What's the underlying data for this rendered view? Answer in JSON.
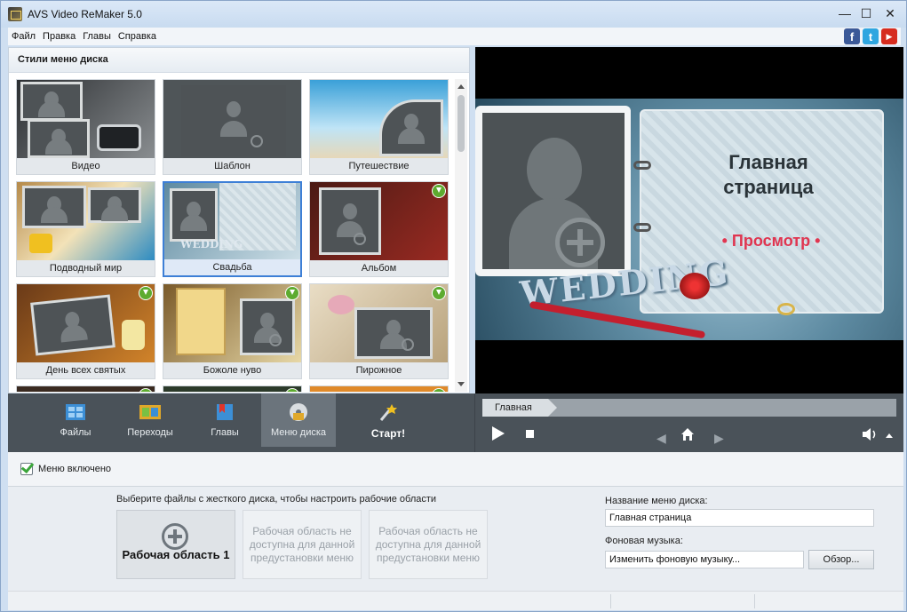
{
  "window": {
    "title": "AVS Video ReMaker 5.0",
    "minimize": "—",
    "maximize": "☐",
    "close": "✕"
  },
  "menu": [
    "Файл",
    "Правка",
    "Главы",
    "Справка"
  ],
  "social": {
    "facebook": "f",
    "twitter": "t",
    "youtube": "▶"
  },
  "styles_panel": {
    "title": "Стили меню диска",
    "tiles": [
      {
        "label": "Видео",
        "download": false
      },
      {
        "label": "Шаблон",
        "download": false
      },
      {
        "label": "Путешествие",
        "download": false
      },
      {
        "label": "Подводный мир",
        "download": false
      },
      {
        "label": "Свадьба",
        "download": false,
        "selected": true
      },
      {
        "label": "Альбом",
        "download": true
      },
      {
        "label": "День всех святых",
        "download": true
      },
      {
        "label": "Божоле нуво",
        "download": true
      },
      {
        "label": "Пирожное",
        "download": true
      }
    ]
  },
  "preview": {
    "title": "Главная страница",
    "link": "• Просмотр •",
    "decor_word": "WEDDING"
  },
  "toolbar": {
    "tools": [
      {
        "label": "Файлы",
        "icon": "film-icon"
      },
      {
        "label": "Переходы",
        "icon": "transitions-icon"
      },
      {
        "label": "Главы",
        "icon": "chapters-icon"
      },
      {
        "label": "Меню диска",
        "icon": "disc-menu-icon"
      },
      {
        "label": "Старт!",
        "icon": "magic-wand-icon"
      }
    ],
    "chapter": "Главная",
    "colors": {
      "toolbar_bg": "#4a5259",
      "active_tool": "#6b747c"
    }
  },
  "settings": {
    "menu_enabled": "Меню включено",
    "hint": "Выберите файлы с жесткого диска, чтобы настроить рабочие области",
    "workspace_active": "Рабочая область 1",
    "workspace_unavailable": "Рабочая область не доступна для данной предустановки меню",
    "menu_name_label": "Название меню диска:",
    "menu_name_value": "Главная страница",
    "music_label": "Фоновая музыка:",
    "music_value": "Изменить фоновую музыку...",
    "browse": "Обзор..."
  }
}
